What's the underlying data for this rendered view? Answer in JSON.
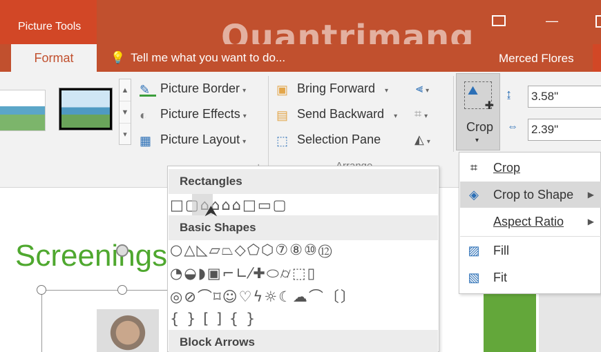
{
  "title_bar": {
    "contextual_group": "Picture Tools",
    "restore_icon": "restore-icon",
    "minimize_label": "—",
    "watermark": "Quantrimang"
  },
  "tabs": {
    "format": "Format",
    "tell_me": "Tell me what you want to do...",
    "user": "Merced Flores"
  },
  "ribbon": {
    "picture_styles": {
      "border": "Picture Border",
      "effects": "Picture Effects",
      "layout": "Picture Layout"
    },
    "arrange": {
      "bring_forward": "Bring Forward",
      "send_backward": "Send Backward",
      "selection_pane": "Selection Pane",
      "group_label": "Arrange"
    },
    "size": {
      "crop_label": "Crop",
      "height": "3.58\"",
      "width": "2.39\""
    }
  },
  "shapes_menu": {
    "rectangles": "Rectangles",
    "rect_row": "□▢⌂⌂⌂⌂□▭▢",
    "basic_shapes": "Basic Shapes",
    "basic_row1": "○△◺▱⏢◇⬠⬡⑦⑧⑩⑫",
    "basic_row2": "◔◒◗▣⌐∟⁄✚⬭⌭⬚▯",
    "basic_row3": "◎⊘⌒⌑☺♡ϟ☼☾☁⌒〔〕",
    "basic_row4": "{ }   [   ]   {   }",
    "block_arrows": "Block Arrows"
  },
  "crop_submenu": {
    "crop": "Crop",
    "crop_to_shape": "Crop to Shape",
    "aspect_ratio": "Aspect Ratio",
    "fill": "Fill",
    "fit": "Fit"
  },
  "slide": {
    "title": "Screenings"
  },
  "colors": {
    "ribbon_accent": "#c1502e",
    "slide_title": "#4fa82f"
  }
}
